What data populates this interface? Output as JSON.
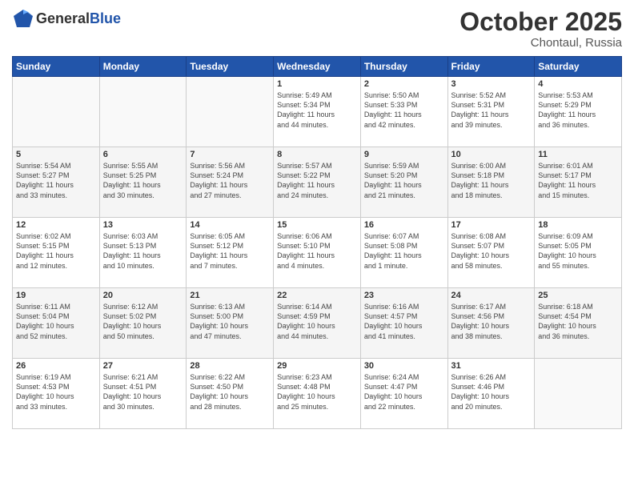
{
  "header": {
    "logo_line1": "General",
    "logo_line2": "Blue",
    "month": "October 2025",
    "location": "Chontaul, Russia"
  },
  "weekdays": [
    "Sunday",
    "Monday",
    "Tuesday",
    "Wednesday",
    "Thursday",
    "Friday",
    "Saturday"
  ],
  "weeks": [
    [
      {
        "day": "",
        "info": ""
      },
      {
        "day": "",
        "info": ""
      },
      {
        "day": "",
        "info": ""
      },
      {
        "day": "1",
        "info": "Sunrise: 5:49 AM\nSunset: 5:34 PM\nDaylight: 11 hours\nand 44 minutes."
      },
      {
        "day": "2",
        "info": "Sunrise: 5:50 AM\nSunset: 5:33 PM\nDaylight: 11 hours\nand 42 minutes."
      },
      {
        "day": "3",
        "info": "Sunrise: 5:52 AM\nSunset: 5:31 PM\nDaylight: 11 hours\nand 39 minutes."
      },
      {
        "day": "4",
        "info": "Sunrise: 5:53 AM\nSunset: 5:29 PM\nDaylight: 11 hours\nand 36 minutes."
      }
    ],
    [
      {
        "day": "5",
        "info": "Sunrise: 5:54 AM\nSunset: 5:27 PM\nDaylight: 11 hours\nand 33 minutes."
      },
      {
        "day": "6",
        "info": "Sunrise: 5:55 AM\nSunset: 5:25 PM\nDaylight: 11 hours\nand 30 minutes."
      },
      {
        "day": "7",
        "info": "Sunrise: 5:56 AM\nSunset: 5:24 PM\nDaylight: 11 hours\nand 27 minutes."
      },
      {
        "day": "8",
        "info": "Sunrise: 5:57 AM\nSunset: 5:22 PM\nDaylight: 11 hours\nand 24 minutes."
      },
      {
        "day": "9",
        "info": "Sunrise: 5:59 AM\nSunset: 5:20 PM\nDaylight: 11 hours\nand 21 minutes."
      },
      {
        "day": "10",
        "info": "Sunrise: 6:00 AM\nSunset: 5:18 PM\nDaylight: 11 hours\nand 18 minutes."
      },
      {
        "day": "11",
        "info": "Sunrise: 6:01 AM\nSunset: 5:17 PM\nDaylight: 11 hours\nand 15 minutes."
      }
    ],
    [
      {
        "day": "12",
        "info": "Sunrise: 6:02 AM\nSunset: 5:15 PM\nDaylight: 11 hours\nand 12 minutes."
      },
      {
        "day": "13",
        "info": "Sunrise: 6:03 AM\nSunset: 5:13 PM\nDaylight: 11 hours\nand 10 minutes."
      },
      {
        "day": "14",
        "info": "Sunrise: 6:05 AM\nSunset: 5:12 PM\nDaylight: 11 hours\nand 7 minutes."
      },
      {
        "day": "15",
        "info": "Sunrise: 6:06 AM\nSunset: 5:10 PM\nDaylight: 11 hours\nand 4 minutes."
      },
      {
        "day": "16",
        "info": "Sunrise: 6:07 AM\nSunset: 5:08 PM\nDaylight: 11 hours\nand 1 minute."
      },
      {
        "day": "17",
        "info": "Sunrise: 6:08 AM\nSunset: 5:07 PM\nDaylight: 10 hours\nand 58 minutes."
      },
      {
        "day": "18",
        "info": "Sunrise: 6:09 AM\nSunset: 5:05 PM\nDaylight: 10 hours\nand 55 minutes."
      }
    ],
    [
      {
        "day": "19",
        "info": "Sunrise: 6:11 AM\nSunset: 5:04 PM\nDaylight: 10 hours\nand 52 minutes."
      },
      {
        "day": "20",
        "info": "Sunrise: 6:12 AM\nSunset: 5:02 PM\nDaylight: 10 hours\nand 50 minutes."
      },
      {
        "day": "21",
        "info": "Sunrise: 6:13 AM\nSunset: 5:00 PM\nDaylight: 10 hours\nand 47 minutes."
      },
      {
        "day": "22",
        "info": "Sunrise: 6:14 AM\nSunset: 4:59 PM\nDaylight: 10 hours\nand 44 minutes."
      },
      {
        "day": "23",
        "info": "Sunrise: 6:16 AM\nSunset: 4:57 PM\nDaylight: 10 hours\nand 41 minutes."
      },
      {
        "day": "24",
        "info": "Sunrise: 6:17 AM\nSunset: 4:56 PM\nDaylight: 10 hours\nand 38 minutes."
      },
      {
        "day": "25",
        "info": "Sunrise: 6:18 AM\nSunset: 4:54 PM\nDaylight: 10 hours\nand 36 minutes."
      }
    ],
    [
      {
        "day": "26",
        "info": "Sunrise: 6:19 AM\nSunset: 4:53 PM\nDaylight: 10 hours\nand 33 minutes."
      },
      {
        "day": "27",
        "info": "Sunrise: 6:21 AM\nSunset: 4:51 PM\nDaylight: 10 hours\nand 30 minutes."
      },
      {
        "day": "28",
        "info": "Sunrise: 6:22 AM\nSunset: 4:50 PM\nDaylight: 10 hours\nand 28 minutes."
      },
      {
        "day": "29",
        "info": "Sunrise: 6:23 AM\nSunset: 4:48 PM\nDaylight: 10 hours\nand 25 minutes."
      },
      {
        "day": "30",
        "info": "Sunrise: 6:24 AM\nSunset: 4:47 PM\nDaylight: 10 hours\nand 22 minutes."
      },
      {
        "day": "31",
        "info": "Sunrise: 6:26 AM\nSunset: 4:46 PM\nDaylight: 10 hours\nand 20 minutes."
      },
      {
        "day": "",
        "info": ""
      }
    ]
  ]
}
